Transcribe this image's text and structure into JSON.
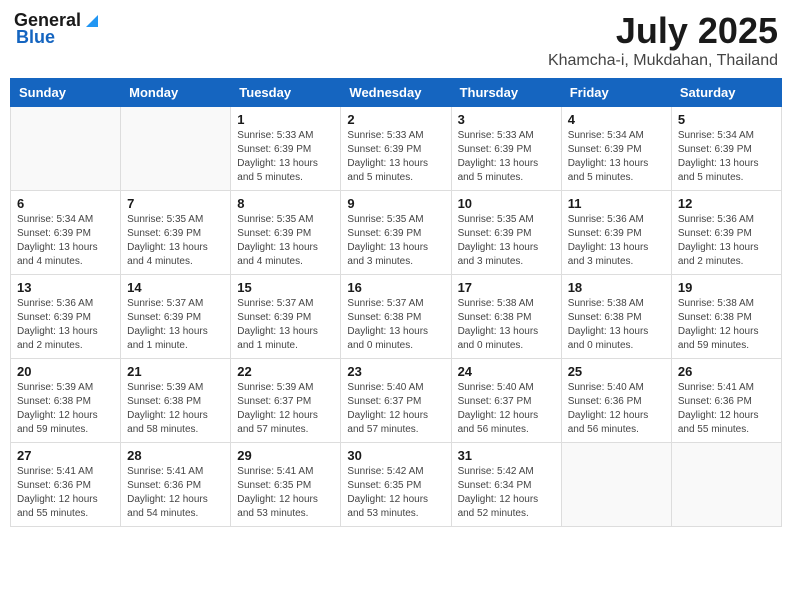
{
  "logo": {
    "general": "General",
    "blue": "Blue"
  },
  "title": {
    "month": "July 2025",
    "location": "Khamcha-i, Mukdahan, Thailand"
  },
  "headers": [
    "Sunday",
    "Monday",
    "Tuesday",
    "Wednesday",
    "Thursday",
    "Friday",
    "Saturday"
  ],
  "weeks": [
    [
      {
        "day": "",
        "info": ""
      },
      {
        "day": "",
        "info": ""
      },
      {
        "day": "1",
        "info": "Sunrise: 5:33 AM\nSunset: 6:39 PM\nDaylight: 13 hours and 5 minutes."
      },
      {
        "day": "2",
        "info": "Sunrise: 5:33 AM\nSunset: 6:39 PM\nDaylight: 13 hours and 5 minutes."
      },
      {
        "day": "3",
        "info": "Sunrise: 5:33 AM\nSunset: 6:39 PM\nDaylight: 13 hours and 5 minutes."
      },
      {
        "day": "4",
        "info": "Sunrise: 5:34 AM\nSunset: 6:39 PM\nDaylight: 13 hours and 5 minutes."
      },
      {
        "day": "5",
        "info": "Sunrise: 5:34 AM\nSunset: 6:39 PM\nDaylight: 13 hours and 5 minutes."
      }
    ],
    [
      {
        "day": "6",
        "info": "Sunrise: 5:34 AM\nSunset: 6:39 PM\nDaylight: 13 hours and 4 minutes."
      },
      {
        "day": "7",
        "info": "Sunrise: 5:35 AM\nSunset: 6:39 PM\nDaylight: 13 hours and 4 minutes."
      },
      {
        "day": "8",
        "info": "Sunrise: 5:35 AM\nSunset: 6:39 PM\nDaylight: 13 hours and 4 minutes."
      },
      {
        "day": "9",
        "info": "Sunrise: 5:35 AM\nSunset: 6:39 PM\nDaylight: 13 hours and 3 minutes."
      },
      {
        "day": "10",
        "info": "Sunrise: 5:35 AM\nSunset: 6:39 PM\nDaylight: 13 hours and 3 minutes."
      },
      {
        "day": "11",
        "info": "Sunrise: 5:36 AM\nSunset: 6:39 PM\nDaylight: 13 hours and 3 minutes."
      },
      {
        "day": "12",
        "info": "Sunrise: 5:36 AM\nSunset: 6:39 PM\nDaylight: 13 hours and 2 minutes."
      }
    ],
    [
      {
        "day": "13",
        "info": "Sunrise: 5:36 AM\nSunset: 6:39 PM\nDaylight: 13 hours and 2 minutes."
      },
      {
        "day": "14",
        "info": "Sunrise: 5:37 AM\nSunset: 6:39 PM\nDaylight: 13 hours and 1 minute."
      },
      {
        "day": "15",
        "info": "Sunrise: 5:37 AM\nSunset: 6:39 PM\nDaylight: 13 hours and 1 minute."
      },
      {
        "day": "16",
        "info": "Sunrise: 5:37 AM\nSunset: 6:38 PM\nDaylight: 13 hours and 0 minutes."
      },
      {
        "day": "17",
        "info": "Sunrise: 5:38 AM\nSunset: 6:38 PM\nDaylight: 13 hours and 0 minutes."
      },
      {
        "day": "18",
        "info": "Sunrise: 5:38 AM\nSunset: 6:38 PM\nDaylight: 13 hours and 0 minutes."
      },
      {
        "day": "19",
        "info": "Sunrise: 5:38 AM\nSunset: 6:38 PM\nDaylight: 12 hours and 59 minutes."
      }
    ],
    [
      {
        "day": "20",
        "info": "Sunrise: 5:39 AM\nSunset: 6:38 PM\nDaylight: 12 hours and 59 minutes."
      },
      {
        "day": "21",
        "info": "Sunrise: 5:39 AM\nSunset: 6:38 PM\nDaylight: 12 hours and 58 minutes."
      },
      {
        "day": "22",
        "info": "Sunrise: 5:39 AM\nSunset: 6:37 PM\nDaylight: 12 hours and 57 minutes."
      },
      {
        "day": "23",
        "info": "Sunrise: 5:40 AM\nSunset: 6:37 PM\nDaylight: 12 hours and 57 minutes."
      },
      {
        "day": "24",
        "info": "Sunrise: 5:40 AM\nSunset: 6:37 PM\nDaylight: 12 hours and 56 minutes."
      },
      {
        "day": "25",
        "info": "Sunrise: 5:40 AM\nSunset: 6:36 PM\nDaylight: 12 hours and 56 minutes."
      },
      {
        "day": "26",
        "info": "Sunrise: 5:41 AM\nSunset: 6:36 PM\nDaylight: 12 hours and 55 minutes."
      }
    ],
    [
      {
        "day": "27",
        "info": "Sunrise: 5:41 AM\nSunset: 6:36 PM\nDaylight: 12 hours and 55 minutes."
      },
      {
        "day": "28",
        "info": "Sunrise: 5:41 AM\nSunset: 6:36 PM\nDaylight: 12 hours and 54 minutes."
      },
      {
        "day": "29",
        "info": "Sunrise: 5:41 AM\nSunset: 6:35 PM\nDaylight: 12 hours and 53 minutes."
      },
      {
        "day": "30",
        "info": "Sunrise: 5:42 AM\nSunset: 6:35 PM\nDaylight: 12 hours and 53 minutes."
      },
      {
        "day": "31",
        "info": "Sunrise: 5:42 AM\nSunset: 6:34 PM\nDaylight: 12 hours and 52 minutes."
      },
      {
        "day": "",
        "info": ""
      },
      {
        "day": "",
        "info": ""
      }
    ]
  ]
}
